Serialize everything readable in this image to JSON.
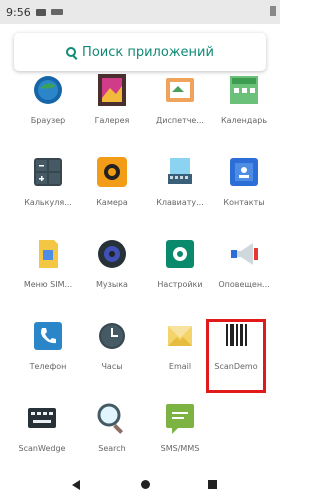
{
  "status_bar": {
    "time": "9:56"
  },
  "search": {
    "label": "Поиск приложений"
  },
  "apps": [
    {
      "label": "Браузер",
      "icon": "browser-icon"
    },
    {
      "label": "Галерея",
      "icon": "gallery-icon"
    },
    {
      "label": "Диспетче...",
      "icon": "file-manager-icon"
    },
    {
      "label": "Календарь",
      "icon": "calendar-icon"
    },
    {
      "label": "Калькуля...",
      "icon": "calculator-icon"
    },
    {
      "label": "Камера",
      "icon": "camera-icon"
    },
    {
      "label": "Клавиату...",
      "icon": "keyboard-icon"
    },
    {
      "label": "Контакты",
      "icon": "contacts-icon"
    },
    {
      "label": "Меню SIM...",
      "icon": "sim-menu-icon"
    },
    {
      "label": "Музыка",
      "icon": "music-icon"
    },
    {
      "label": "Настройки",
      "icon": "settings-icon"
    },
    {
      "label": "Оповещен...",
      "icon": "alerts-icon"
    },
    {
      "label": "Телефон",
      "icon": "phone-icon"
    },
    {
      "label": "Часы",
      "icon": "clock-icon"
    },
    {
      "label": "Email",
      "icon": "email-icon"
    },
    {
      "label": "ScanDemo",
      "icon": "barcode-icon"
    },
    {
      "label": "ScanWedge",
      "icon": "scanwedge-icon"
    },
    {
      "label": "Search",
      "icon": "magnifier-icon"
    },
    {
      "label": "SMS/MMS",
      "icon": "sms-icon"
    }
  ],
  "nav": {
    "back": "back-icon",
    "home": "home-icon",
    "recents": "recents-icon"
  }
}
